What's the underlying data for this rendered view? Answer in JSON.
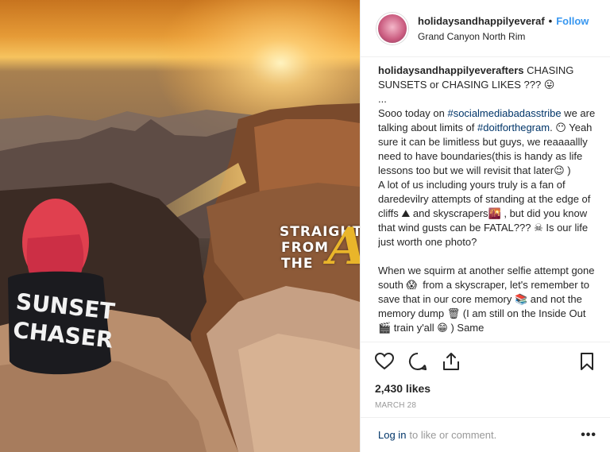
{
  "post": {
    "username": "holidaysandhappilyeveraf",
    "separator": "•",
    "follow_label": "Follow",
    "location": "Grand Canyon North Rim"
  },
  "photo": {
    "watermark": {
      "line1": "STRAIGHT",
      "line2": "FROM",
      "line3": "THE",
      "logo_letter": "A"
    },
    "shirt": {
      "line1": "SUNSET",
      "line2": "CHASER"
    }
  },
  "caption": {
    "author": "holidaysandhappilyeverafters",
    "intro": " CHASING SUNSETS or CHASING LIKES ??? 😛",
    "ellipsis": "...",
    "p1_a": "Sooo today on ",
    "tag1": "#socialmediabadasstribe",
    "p1_b": " we are talking about limits of ",
    "tag2": "#doitforthegram",
    "p1_c": ". 😶 Yeah sure it can be limitless but guys, we reaaaallly need to have boundaries(this is handy as life lessons too but we will revisit that later😉 )",
    "p2": "A lot of us including yours truly is a fan of daredevilry attempts of standing at the edge of cliffs ⛰ and skyscrapers🌇 , but did you know that wind gusts can be FATAL??? ☠ Is our life just worth one photo?",
    "p3": "When we squirm at another selfie attempt gone south 😱  from a skyscraper, let's remember to save that in our core memory 📚 and not the memory dump 🗑 (I am still on the Inside Out 🎬 train y'all 😁 ) Same"
  },
  "actions": {
    "likes": "2,430 likes",
    "date": "MARCH 28"
  },
  "footer": {
    "login_label": "Log in",
    "prompt": "to like or comment.",
    "more": "•••"
  },
  "colors": {
    "link_blue": "#3897f0",
    "hashtag_navy": "#003569",
    "muted_grey": "#999999"
  }
}
